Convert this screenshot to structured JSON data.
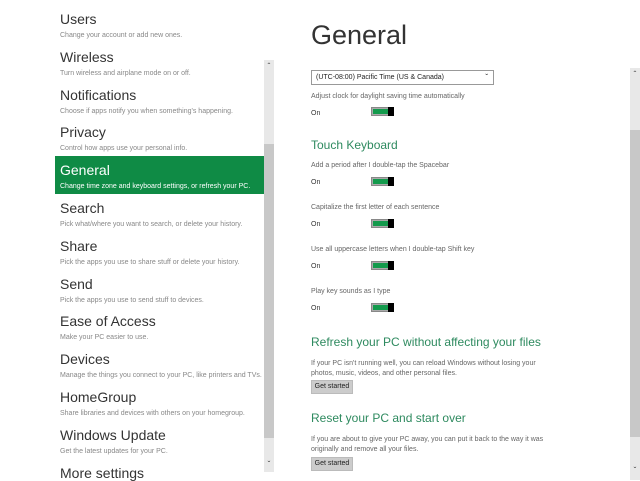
{
  "sidebar": {
    "items": [
      {
        "title": "Users",
        "desc": "Change your account or add new ones."
      },
      {
        "title": "Wireless",
        "desc": "Turn wireless and airplane mode on or off."
      },
      {
        "title": "Notifications",
        "desc": "Choose if apps notify you when something's happening."
      },
      {
        "title": "Privacy",
        "desc": "Control how apps use your personal info."
      },
      {
        "title": "General",
        "desc": "Change time zone and keyboard settings, or refresh your PC.",
        "selected": true
      },
      {
        "title": "Search",
        "desc": "Pick what/where you want to search, or delete your history."
      },
      {
        "title": "Share",
        "desc": "Pick the apps you use to share stuff or delete your history."
      },
      {
        "title": "Send",
        "desc": "Pick the apps you use to send stuff to devices."
      },
      {
        "title": "Ease of Access",
        "desc": "Make your PC easier to use."
      },
      {
        "title": "Devices",
        "desc": "Manage the things you connect to your PC, like printers and TVs."
      },
      {
        "title": "HomeGroup",
        "desc": "Share libraries and devices with others on your homegroup."
      },
      {
        "title": "Windows Update",
        "desc": "Get the latest updates for your PC."
      },
      {
        "title": "More settings",
        "desc": ""
      }
    ],
    "accent": "#0f8b45"
  },
  "main": {
    "title": "General",
    "timezone": "(UTC-08:00) Pacific Time (US & Canada)",
    "dst_label": "Adjust clock for daylight saving time automatically",
    "dst_state": "On",
    "touch_heading": "Touch Keyboard",
    "toggles": [
      {
        "label": "Add a period after I double-tap the Spacebar",
        "state": "On"
      },
      {
        "label": "Capitalize the first letter of each sentence",
        "state": "On"
      },
      {
        "label": "Use all uppercase letters when I double-tap Shift key",
        "state": "On"
      },
      {
        "label": "Play key sounds as I type",
        "state": "On"
      }
    ],
    "refresh": {
      "heading": "Refresh your PC without affecting your files",
      "text": "If your PC isn't running well, you can reload Windows without losing your photos, music, videos, and other personal files.",
      "button": "Get started"
    },
    "reset": {
      "heading": "Reset your PC and start over",
      "text": "If you are about to give your PC away, you can put it back to the way it was originally and remove all your files.",
      "button": "Get started"
    }
  }
}
